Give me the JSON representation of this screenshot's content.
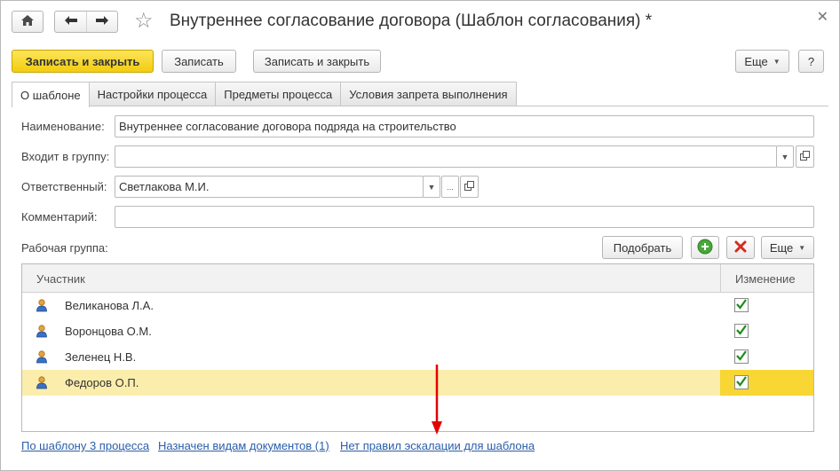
{
  "window": {
    "title": "Внутреннее согласование договора (Шаблон согласования) *"
  },
  "toolbar": {
    "write_close_primary": "Записать и закрыть",
    "write": "Записать",
    "write_close": "Записать и закрыть",
    "more": "Еще",
    "help": "?"
  },
  "tabs": [
    {
      "label": "О шаблоне",
      "active": true
    },
    {
      "label": "Настройки процесса",
      "active": false
    },
    {
      "label": "Предметы процесса",
      "active": false
    },
    {
      "label": "Условия запрета выполнения",
      "active": false
    }
  ],
  "form": {
    "name_label": "Наименование:",
    "name_value": "Внутреннее согласование договора подряда на строительство",
    "group_label": "Входит в группу:",
    "group_value": "",
    "responsible_label": "Ответственный:",
    "responsible_value": "Светлакова М.И.",
    "comment_label": "Комментарий:",
    "comment_value": ""
  },
  "workgroup": {
    "label": "Рабочая группа:",
    "pick_button": "Подобрать",
    "more": "Еще",
    "columns": [
      "Участник",
      "Изменение"
    ],
    "rows": [
      {
        "name": "Великанова Л.А.",
        "change": true,
        "selected": false
      },
      {
        "name": "Воронцова О.М.",
        "change": true,
        "selected": false
      },
      {
        "name": "Зеленец Н.В.",
        "change": true,
        "selected": false
      },
      {
        "name": "Федоров О.П.",
        "change": true,
        "selected": true
      }
    ]
  },
  "links": [
    "По шаблону 3 процесса",
    "Назначен видам документов (1)",
    "Нет правил эскалации для шаблона"
  ],
  "icons": {
    "home": "home-icon",
    "back": "arrow-left-icon",
    "forward": "arrow-right-icon",
    "favorite": "star-icon",
    "close": "close-icon",
    "add": "add-icon",
    "delete": "delete-icon",
    "person": "user-icon",
    "check": "checkmark-icon"
  },
  "colors": {
    "primary_button": "#f3cd10",
    "selected_row": "#fbedab",
    "selected_cell": "#f8d634",
    "link": "#2a5ea8",
    "annotation_arrow": "#e30000"
  }
}
